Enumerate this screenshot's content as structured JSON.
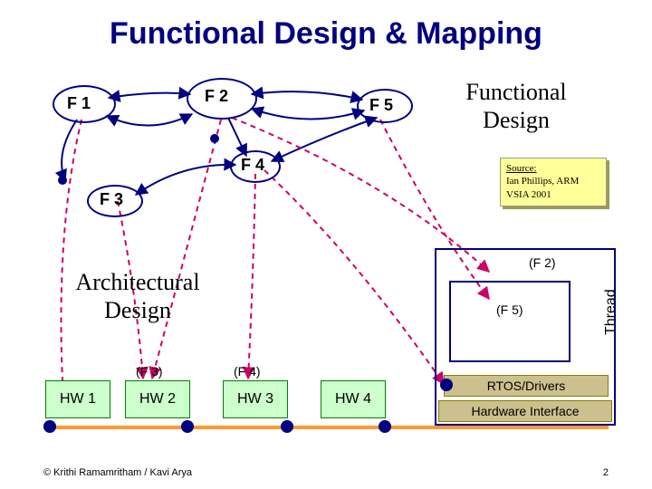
{
  "title": "Functional Design & Mapping",
  "section_functional": "Functional\nDesign",
  "section_architectural": "Architectural\nDesign",
  "nodes": {
    "f1": "F 1",
    "f2": "F 2",
    "f3": "F 3",
    "f4": "F 4",
    "f5": "F 5"
  },
  "paren": {
    "f2": "(F 2)",
    "f3": "(F 3)",
    "f4": "(F 4)",
    "f5": "(F 5)"
  },
  "hw": {
    "hw1": "HW 1",
    "hw2": "HW 2",
    "hw3": "HW 3",
    "hw4": "HW 4"
  },
  "bars": {
    "rtos": "RTOS/Drivers",
    "hwif": "Hardware Interface"
  },
  "thread": "Thread",
  "source": {
    "line1": "Source:",
    "line2": "Ian Phillips, ARM",
    "line3": "VSIA 2001"
  },
  "footer_left": "© Krithi Ramamritham / Kavi Arya",
  "footer_right": "2"
}
